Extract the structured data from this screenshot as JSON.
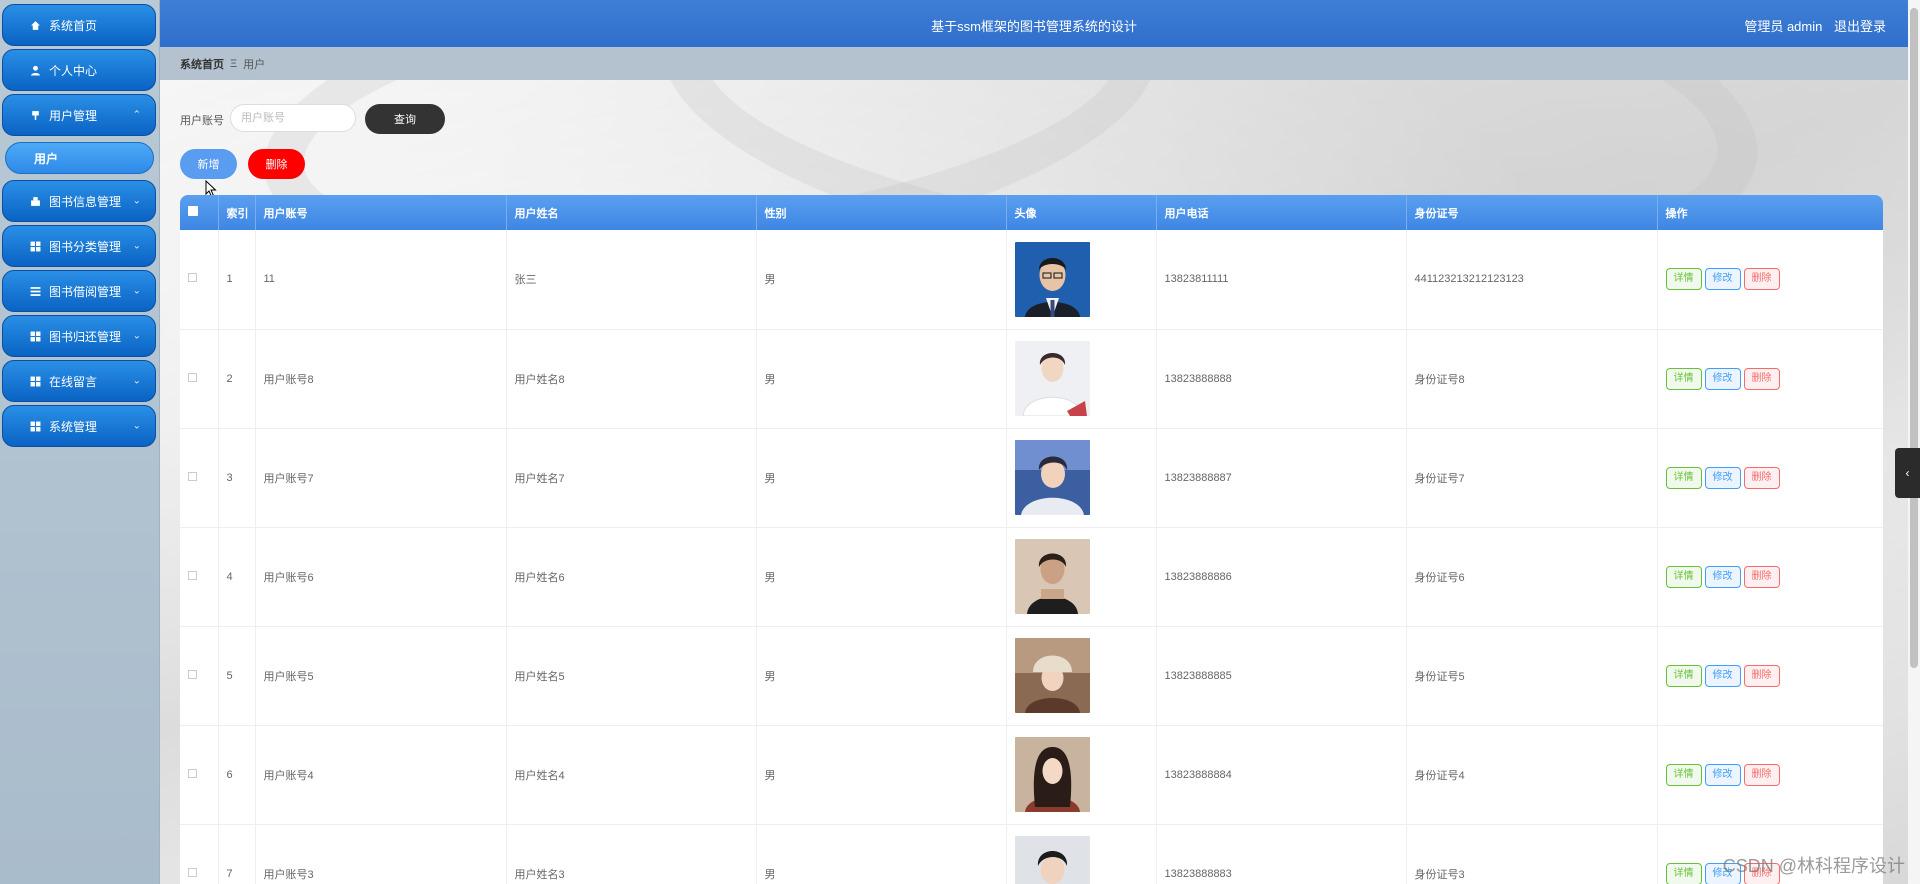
{
  "sidebar": {
    "items": [
      {
        "label": "系统首页",
        "icon": "home-icon",
        "chevron": ""
      },
      {
        "label": "个人中心",
        "icon": "user-icon",
        "chevron": ""
      },
      {
        "label": "用户管理",
        "icon": "pin-icon",
        "chevron": "^"
      },
      {
        "label": "图书信息管理",
        "icon": "book-icon",
        "chevron": "v"
      },
      {
        "label": "图书分类管理",
        "icon": "grid-icon",
        "chevron": "v"
      },
      {
        "label": "图书借阅管理",
        "icon": "list-icon",
        "chevron": "v"
      },
      {
        "label": "图书归还管理",
        "icon": "grid-icon",
        "chevron": "v"
      },
      {
        "label": "在线留言",
        "icon": "grid-icon",
        "chevron": "v"
      },
      {
        "label": "系统管理",
        "icon": "grid-icon",
        "chevron": "v"
      }
    ],
    "sub_item": "用户"
  },
  "header": {
    "title": "基于ssm框架的图书管理系统的设计",
    "user": "管理员 admin",
    "logout": "退出登录"
  },
  "breadcrumb": {
    "home": "系统首页",
    "separator": "Ξ",
    "current": "用户"
  },
  "search": {
    "label": "用户账号",
    "placeholder": "用户账号",
    "value": "",
    "query_button": "查询"
  },
  "actions": {
    "add": "新增",
    "delete": "删除"
  },
  "table": {
    "headers": [
      "索引",
      "用户账号",
      "用户姓名",
      "性别",
      "头像",
      "用户电话",
      "身份证号",
      "操作"
    ],
    "rows": [
      {
        "index": "1",
        "account": "11",
        "name": "张三",
        "gender": "男",
        "phone": "13823811111",
        "id_card": "441123213212123123"
      },
      {
        "index": "2",
        "account": "用户账号8",
        "name": "用户姓名8",
        "gender": "男",
        "phone": "13823888888",
        "id_card": "身份证号8"
      },
      {
        "index": "3",
        "account": "用户账号7",
        "name": "用户姓名7",
        "gender": "男",
        "phone": "13823888887",
        "id_card": "身份证号7"
      },
      {
        "index": "4",
        "account": "用户账号6",
        "name": "用户姓名6",
        "gender": "男",
        "phone": "13823888886",
        "id_card": "身份证号6"
      },
      {
        "index": "5",
        "account": "用户账号5",
        "name": "用户姓名5",
        "gender": "男",
        "phone": "13823888885",
        "id_card": "身份证号5"
      },
      {
        "index": "6",
        "account": "用户账号4",
        "name": "用户姓名4",
        "gender": "男",
        "phone": "13823888884",
        "id_card": "身份证号4"
      },
      {
        "index": "7",
        "account": "用户账号3",
        "name": "用户姓名3",
        "gender": "男",
        "phone": "13823888883",
        "id_card": "身份证号3"
      }
    ],
    "row_buttons": {
      "detail": "详情",
      "edit": "修改",
      "remove": "删除"
    }
  },
  "watermark": "CSDN @林科程序设计",
  "colors": {
    "header_blue": "#3f7fd6",
    "menu_blue": "#0a63c4",
    "table_header_blue": "#4a92ea",
    "delete_red": "#ff0000",
    "query_dark": "#333333"
  }
}
